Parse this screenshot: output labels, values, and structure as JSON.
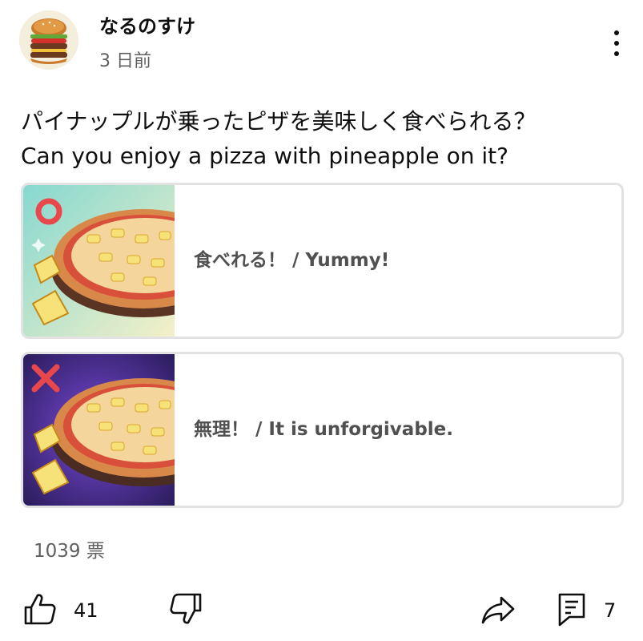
{
  "post": {
    "channel_name": "なるのすけ",
    "time": "3 日前",
    "question_jp": "パイナップルが乗ったピザを美味しく食べられる？",
    "question_en": "Can you enjoy a pizza with pineapple on it?"
  },
  "poll": {
    "options": [
      {
        "label": "食べれる！ / Yummy!",
        "icon": "circle-mark-icon",
        "accent": "#e8474b"
      },
      {
        "label": "無理！ / It is unforgivable.",
        "icon": "cross-mark-icon",
        "accent": "#e8474b"
      }
    ],
    "votes": "1039 票"
  },
  "actions": {
    "likes": "41",
    "comments": "7"
  },
  "icons": [
    "avatar-burger-icon",
    "more-vert-icon",
    "thumbs-up-icon",
    "thumbs-down-icon",
    "share-icon",
    "comment-icon"
  ]
}
